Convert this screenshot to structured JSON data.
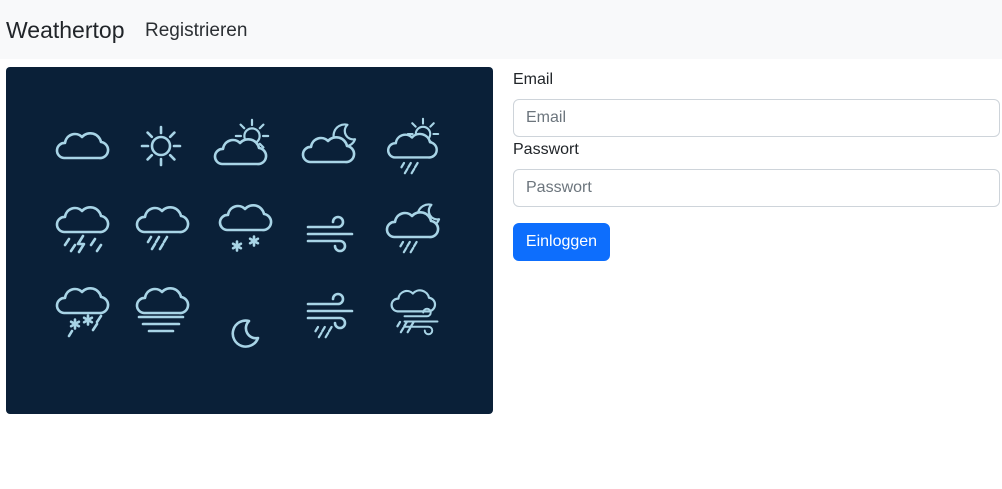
{
  "navbar": {
    "brand": "Weathertop",
    "links": [
      {
        "label": "Registrieren"
      }
    ]
  },
  "hero": {
    "background": "#0a2038",
    "icon_color": "#a8d4e6",
    "icons": [
      "cloud-icon",
      "sun-icon",
      "partly-sunny-icon",
      "cloudy-night-icon",
      "sun-shower-icon",
      "thunderstorm-icon",
      "rain-icon",
      "snow-icon",
      "wind-icon",
      "night-rain-icon",
      "sleet-icon",
      "fog-icon",
      "moon-icon",
      "windy-rain-icon",
      "storm-wind-icon"
    ]
  },
  "login_form": {
    "email_label": "Email",
    "email_placeholder": "Email",
    "email_value": "",
    "password_label": "Passwort",
    "password_placeholder": "Passwort",
    "password_value": "",
    "submit_label": "Einloggen",
    "accent_color": "#0d6efd"
  }
}
